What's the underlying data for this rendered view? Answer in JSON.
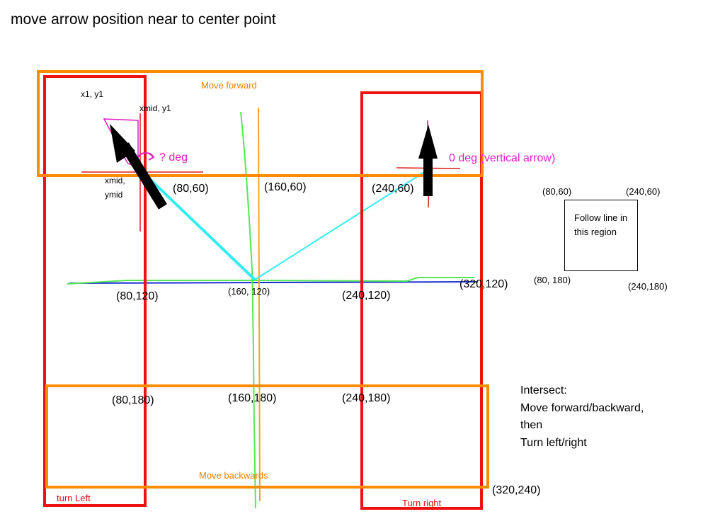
{
  "title": "move arrow position near to center point",
  "regions": {
    "move_forward": "Move forward",
    "move_backwards": "Move backwards",
    "turn_left": "turn Left",
    "turn_right": "Turn right"
  },
  "arrow_labels": {
    "x1_y1": "x1, y1",
    "xmid_y1": "xmid, y1",
    "xmid": "xmid,",
    "ymid": "ymid",
    "unknown_angle": "? deg",
    "zero_angle": "0 deg (vertical arrow)"
  },
  "grid_labels": {
    "p80_60": "(80,60)",
    "p160_60": "(160,60)",
    "p240_60": "(240,60)",
    "p80_120": "(80,120)",
    "p160_120": "(160, 120)",
    "p240_120": "(240,120)",
    "p320_120": "(320,120)",
    "p80_180": "(80,180)",
    "p160_180": "(160,180)",
    "p240_180": "(240,180)",
    "p320_240": "(320,240)"
  },
  "follow_box": {
    "top_left": "(80,60)",
    "top_right": "(240,60)",
    "bottom_left": "(80, 180)",
    "bottom_right": "(240,180)",
    "text": "Follow line in this region"
  },
  "note": {
    "line1": "Intersect:",
    "line2": "Move forward/backward,",
    "line3": "then",
    "line4": "Turn left/right"
  },
  "colors": {
    "region_orange": "#ff8c00",
    "region_red": "#ee1111",
    "axis_blue": "#1a2fd6",
    "line_green": "#55e855",
    "line_cyan": "#33eeee",
    "vline_orange": "#f5a623",
    "annotation_magenta": "#e020c0"
  }
}
